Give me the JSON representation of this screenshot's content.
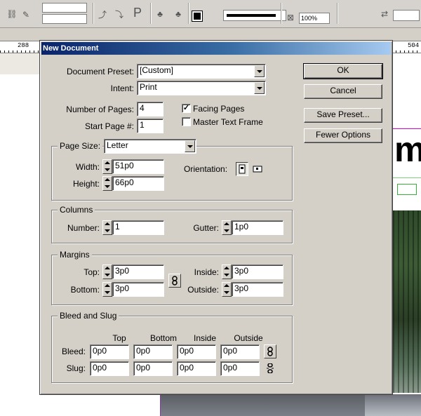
{
  "app": {
    "toolbar_zoom": "100%",
    "ruler_labels": [
      "288",
      "504"
    ]
  },
  "dialog": {
    "title": "New Document",
    "preset_label": "Document Preset:",
    "preset_value": "[Custom]",
    "intent_label": "Intent:",
    "intent_value": "Print",
    "pages_label": "Number of Pages:",
    "pages_value": "4",
    "start_page_label": "Start Page #:",
    "start_page_value": "1",
    "facing_pages_label": "Facing Pages",
    "facing_pages_checked": true,
    "master_frame_label": "Master Text Frame",
    "master_frame_checked": false,
    "page_size": {
      "label": "Page Size:",
      "value": "Letter",
      "width_label": "Width:",
      "width_value": "51p0",
      "height_label": "Height:",
      "height_value": "66p0",
      "orientation_label": "Orientation:"
    },
    "columns": {
      "title": "Columns",
      "number_label": "Number:",
      "number_value": "1",
      "gutter_label": "Gutter:",
      "gutter_value": "1p0"
    },
    "margins": {
      "title": "Margins",
      "top_label": "Top:",
      "top_value": "3p0",
      "bottom_label": "Bottom:",
      "bottom_value": "3p0",
      "inside_label": "Inside:",
      "inside_value": "3p0",
      "outside_label": "Outside:",
      "outside_value": "3p0"
    },
    "bleed_slug": {
      "title": "Bleed and Slug",
      "columns": [
        "Top",
        "Bottom",
        "Inside",
        "Outside"
      ],
      "bleed_label": "Bleed:",
      "bleed_values": [
        "0p0",
        "0p0",
        "0p0",
        "0p0"
      ],
      "slug_label": "Slug:",
      "slug_values": [
        "0p0",
        "0p0",
        "0p0",
        "0p0"
      ]
    },
    "buttons": {
      "ok": "OK",
      "cancel": "Cancel",
      "save_preset": "Save Preset...",
      "fewer_options": "Fewer Options"
    }
  }
}
